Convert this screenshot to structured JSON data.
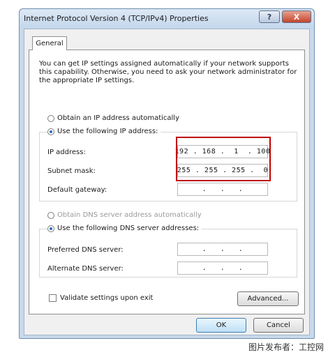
{
  "window": {
    "title": "Internet Protocol Version 4 (TCP/IPv4) Properties",
    "help_label": "?",
    "close_label": "X"
  },
  "tabs": [
    "General"
  ],
  "description": "You can get IP settings assigned automatically if your network supports this capability. Otherwise, you need to ask your network administrator for the appropriate IP settings.",
  "ip_settings": {
    "auto_option": "Obtain an IP address automatically",
    "manual_option": "Use the following IP address:",
    "selected": "manual",
    "fields": [
      {
        "label": "IP address:",
        "value": "192 . 168 .  1  . 100"
      },
      {
        "label": "Subnet mask:",
        "value": "255 . 255 . 255 .  0"
      },
      {
        "label": "Default gateway:",
        "value": " .   .   . "
      }
    ]
  },
  "dns_settings": {
    "auto_option": "Obtain DNS server address automatically",
    "manual_option": "Use the following DNS server addresses:",
    "selected": "manual",
    "fields": [
      {
        "label": "Preferred DNS server:",
        "value": " .   .   . "
      },
      {
        "label": "Alternate DNS server:",
        "value": " .   .   . "
      }
    ]
  },
  "validate_label": "Validate settings upon exit",
  "validate_checked": false,
  "buttons": {
    "advanced": "Advanced...",
    "ok": "OK",
    "cancel": "Cancel"
  },
  "watermark": "图片发布者：工控网",
  "colors": {
    "highlight": "#c00000",
    "radio_selected": "#2a6fc2"
  }
}
